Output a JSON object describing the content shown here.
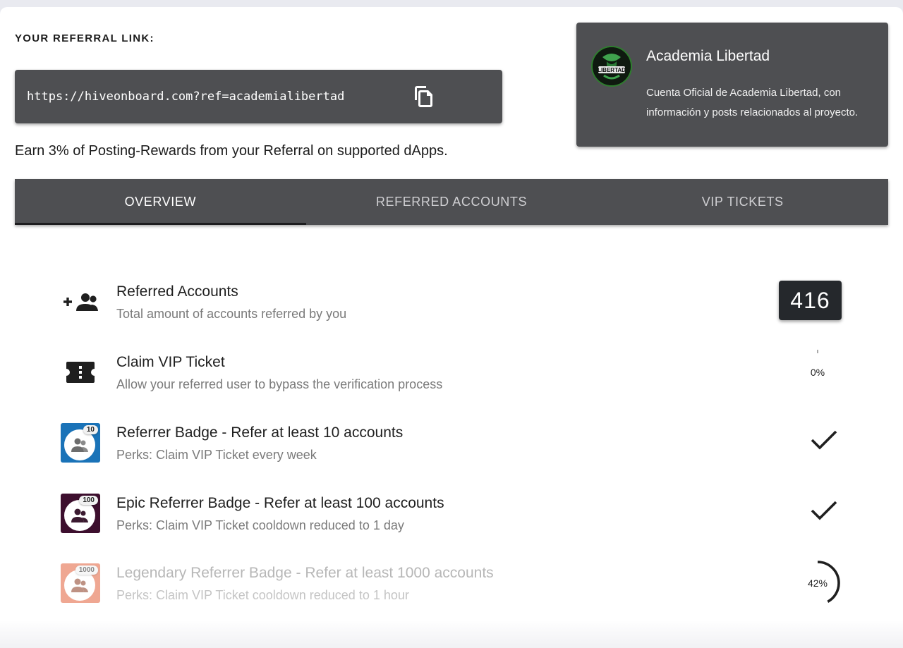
{
  "referral": {
    "heading": "YOUR REFERRAL LINK:",
    "link": "https://hiveonboard.com?ref=academialibertad",
    "earn_text": "Earn 3% of Posting-Rewards from your Referral on supported dApps."
  },
  "profile": {
    "name": "Academia Libertad",
    "description": "Cuenta Oficial de Academia Libertad, con información y posts relacionados al proyecto.",
    "avatar_text": "LIBERTAD"
  },
  "tabs": [
    {
      "label": "OVERVIEW",
      "active": true
    },
    {
      "label": "REFERRED ACCOUNTS",
      "active": false
    },
    {
      "label": "VIP TICKETS",
      "active": false
    }
  ],
  "overview": [
    {
      "title": "Referred Accounts",
      "subtitle": "Total amount of accounts referred by you",
      "icon": "add-group-icon",
      "value": "416"
    },
    {
      "title": "Claim VIP Ticket",
      "subtitle": "Allow your referred user to bypass the verification process",
      "icon": "ticket-icon",
      "progress": 0,
      "progress_label": "0%"
    },
    {
      "title": "Referrer Badge - Refer at least 10 accounts",
      "subtitle": "Perks: Claim VIP Ticket every week",
      "icon": "referrer-badge-icon",
      "badge_number": "10",
      "badge_color": "#1a73b8",
      "completed": true
    },
    {
      "title": "Epic Referrer Badge - Refer at least 100 accounts",
      "subtitle": "Perks: Claim VIP Ticket cooldown reduced to 1 day",
      "icon": "epic-referrer-badge-icon",
      "badge_number": "100",
      "badge_color": "#3d0f2e",
      "completed": true
    },
    {
      "title": "Legendary Referrer Badge - Refer at least 1000 accounts",
      "subtitle": "Perks: Claim VIP Ticket cooldown reduced to 1 hour",
      "icon": "legendary-referrer-badge-icon",
      "badge_number": "1000",
      "badge_color": "#e2603a",
      "progress": 0.42,
      "progress_label": "42%"
    }
  ],
  "colors": {
    "panel": "#4e4f52",
    "chip": "#25282c",
    "accent_green": "#2e7d2e"
  }
}
